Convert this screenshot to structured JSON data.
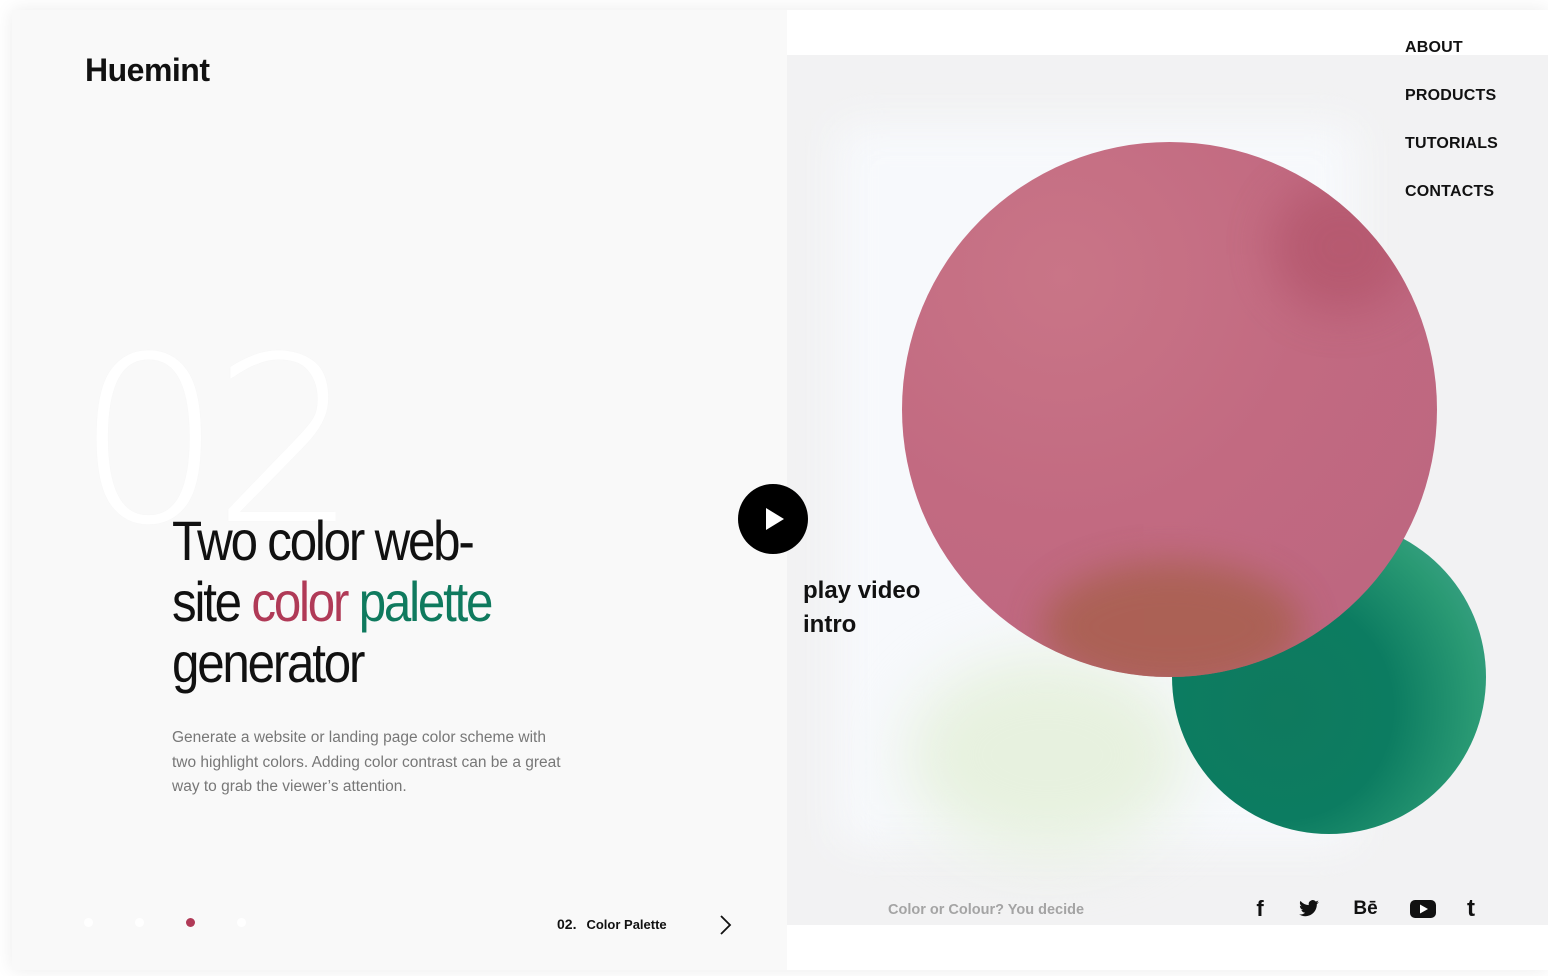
{
  "brand": {
    "logo": "Huemint"
  },
  "nav": {
    "items": [
      {
        "label": "ABOUT"
      },
      {
        "label": "PRODUCTS"
      },
      {
        "label": "TUTORIALS"
      },
      {
        "label": "CONTACTS"
      }
    ]
  },
  "hero": {
    "slide_number": "02",
    "headline": {
      "line1": "Two color web-",
      "line2_prefix": "site ",
      "line2_red": "color",
      "line2_space": " ",
      "line2_green": "palette",
      "line3": "generator"
    },
    "description": "Generate a website or landing page color scheme with two highlight colors. Adding color contrast can be a great way to grab the viewer’s attention."
  },
  "slider": {
    "dots": 4,
    "active_dot_index": 2,
    "current_number": "02.",
    "current_label": "Color Palette",
    "next_icon": "chevron-right-icon"
  },
  "video": {
    "play_icon": "play-icon",
    "label_line1": "play video",
    "label_line2": "intro"
  },
  "footer": {
    "tagline": "Color or Colour? You decide",
    "social": [
      {
        "icon": "facebook-icon",
        "glyph": "f"
      },
      {
        "icon": "twitter-icon",
        "glyph": ""
      },
      {
        "icon": "behance-icon",
        "glyph": "Bē"
      },
      {
        "icon": "youtube-icon",
        "glyph": ""
      },
      {
        "icon": "tumblr-icon",
        "glyph": "t"
      }
    ]
  },
  "colors": {
    "accent_red": "#b03a57",
    "accent_green": "#0f7a5e",
    "circle_red": "#c26a81",
    "circle_green": "#0c7c61",
    "background": "#f9f9f9"
  }
}
